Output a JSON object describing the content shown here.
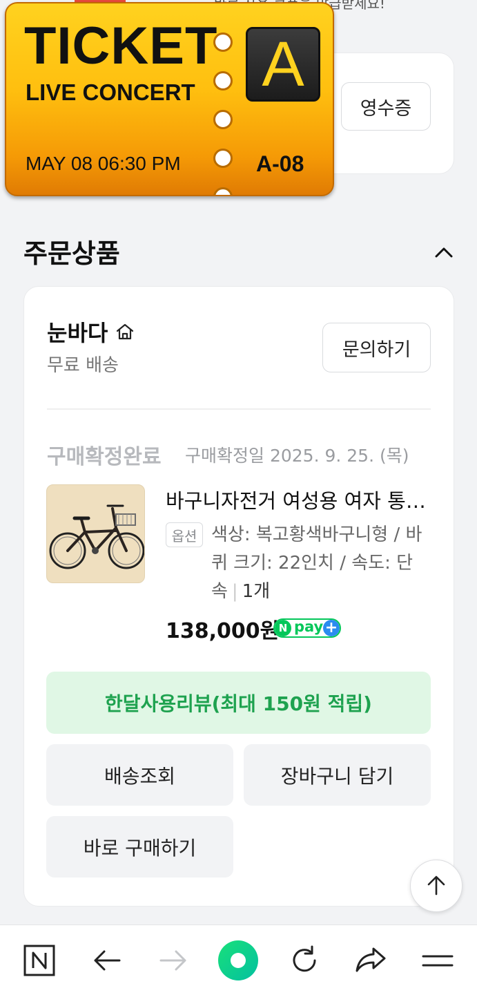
{
  "top_partial": {
    "text": "바로 사용 쿠폰을 발급받세요!"
  },
  "receipt_button": "영수증",
  "ticket_overlay": {
    "title": "TICKET",
    "subtitle": "LIVE CONCERT",
    "datetime": "MAY 08 06:30 PM",
    "seat": "A-08",
    "letter": "A"
  },
  "section": {
    "title": "주문상품"
  },
  "seller": {
    "name": "눈바다",
    "shipping": "무료 배송",
    "inquiry_button": "문의하기"
  },
  "order": {
    "status": "구매확정완료",
    "confirm_date": "구매확정일 2025. 9. 25. (목)",
    "product_name": "바구니자전거 여성용 여자 통학용 클래식 자전거",
    "option_badge": "옵션",
    "option_text": "색상: 복고황색바구니형 / 바퀴 크기: 22인치 / 속도: 단속",
    "quantity": "1개",
    "price": "138,000원",
    "npay_label": "pay",
    "npay_n": "N",
    "npay_plus": "+"
  },
  "actions": {
    "review": "한달사용리뷰(최대 150원 적립)",
    "track": "배송조회",
    "cart": "장바구니 담기",
    "buy_again": "바로 구매하기"
  },
  "colors": {
    "accent_green": "#03c75a",
    "review_bg": "#e0f7e5",
    "review_text": "#1ea24f",
    "ticket_yellow": "#ffbf0f"
  },
  "icons": {
    "scroll_top": "arrow-up-icon",
    "nav": [
      "naver-n-icon",
      "back-arrow-icon",
      "forward-arrow-icon",
      "home-circle-icon",
      "refresh-icon",
      "share-icon",
      "menu-icon"
    ]
  }
}
